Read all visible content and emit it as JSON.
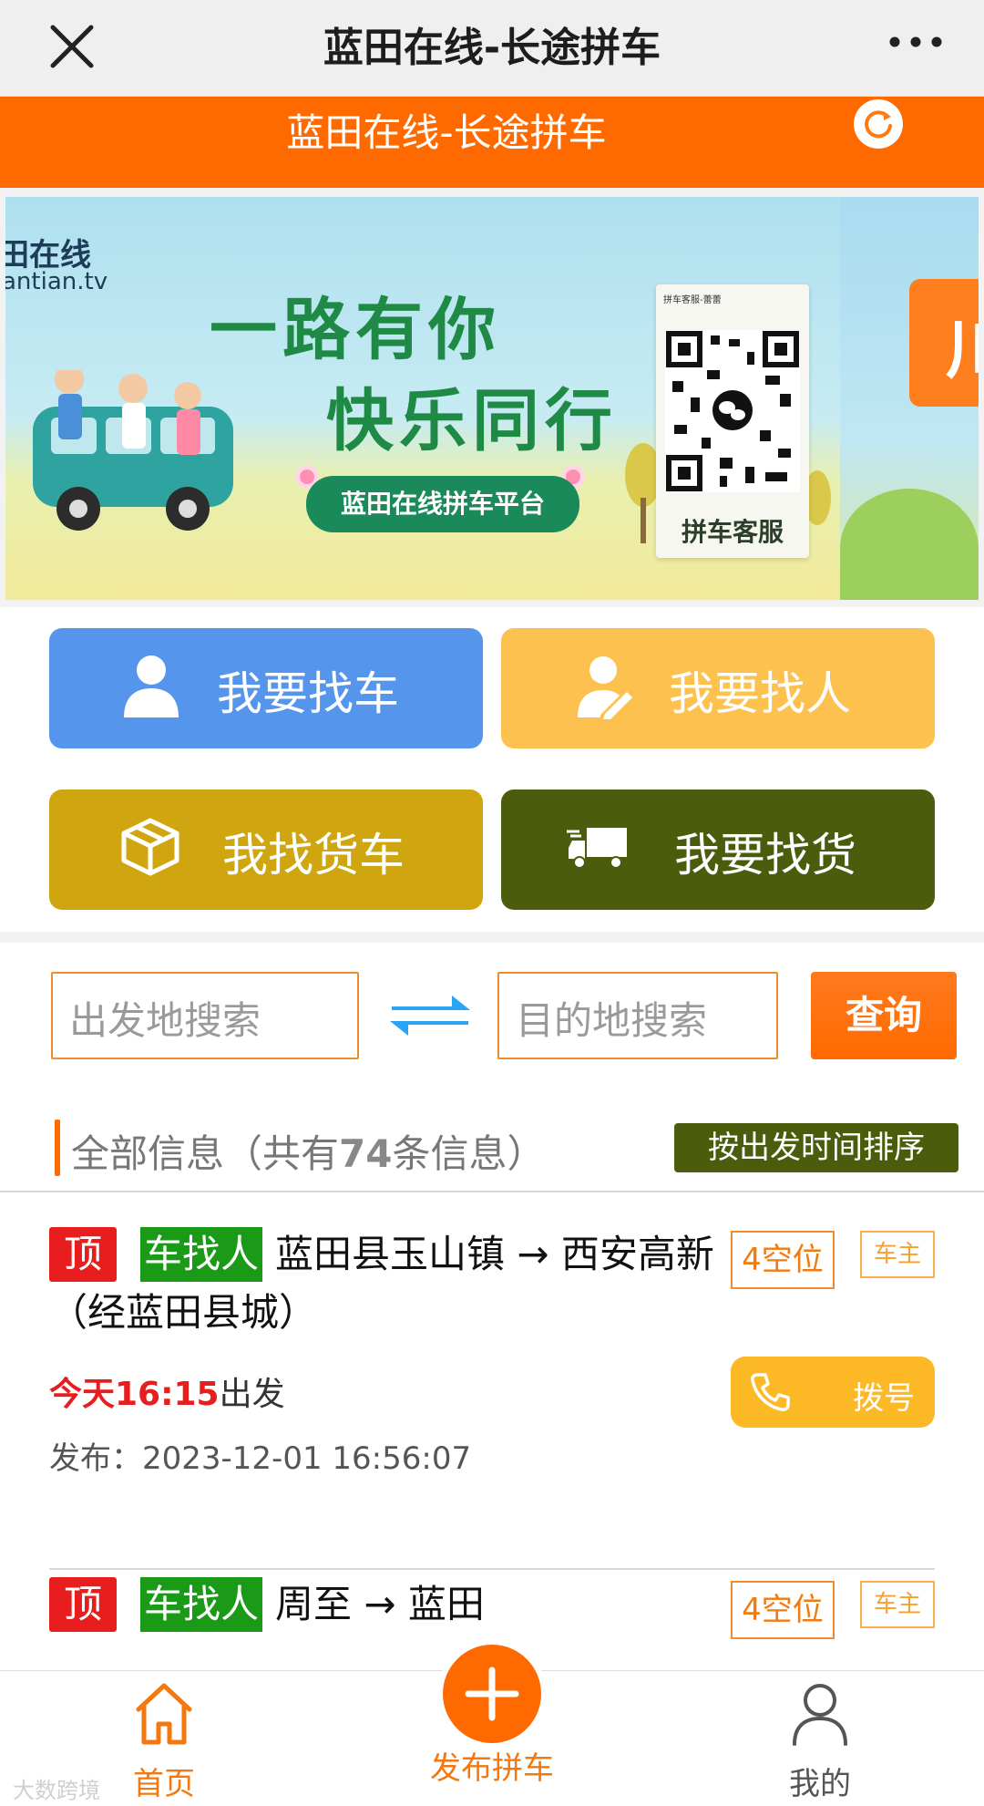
{
  "navbar": {
    "title": "蓝田在线-长途拼车"
  },
  "header": {
    "title": "蓝田在线-长途拼车"
  },
  "banner": {
    "logo_text": "田在线",
    "logo_sub": "antian.tv",
    "headline_1": "一路有你",
    "headline_2": "快乐同行",
    "platform": "蓝田在线拼车平台",
    "qr_top": "拼车客服-蕾蕾",
    "qr_caption": "拼车客服",
    "next_slide_text": "川"
  },
  "actions": {
    "find_car": "我要找车",
    "find_person": "我要找人",
    "find_truck": "我找货车",
    "find_cargo": "我要找货"
  },
  "search": {
    "from_placeholder": "出发地搜索",
    "to_placeholder": "目的地搜索",
    "query_label": "查询"
  },
  "list": {
    "title_prefix": "全部信息（共有",
    "count": "74",
    "title_suffix": "条信息）",
    "sort_label": "按出发时间排序"
  },
  "rides": [
    {
      "top_tag": "顶",
      "kind_tag": "车找人",
      "route": "蓝田县玉山镇 → 西安高新（经蓝田县城）",
      "seats": "4空位",
      "owner": "车主",
      "call_label": "拨号",
      "depart_time": "今天16:15",
      "depart_suffix": "出发",
      "posted": "发布：2023-12-01 16:56:07"
    },
    {
      "top_tag": "顶",
      "kind_tag": "车找人",
      "route": "周至 → 蓝田",
      "seats": "4空位",
      "owner": "车主"
    }
  ],
  "tabbar": {
    "home": "首页",
    "publish": "发布拼车",
    "mine": "我的"
  },
  "watermark": "大数跨境",
  "colors": {
    "orange": "#ff6a00",
    "blue": "#5595ec",
    "yellow": "#fdc150",
    "mustard": "#cfa60f",
    "olive": "#4b5d0d",
    "red": "#e81e1e",
    "green": "#1a9a16"
  }
}
